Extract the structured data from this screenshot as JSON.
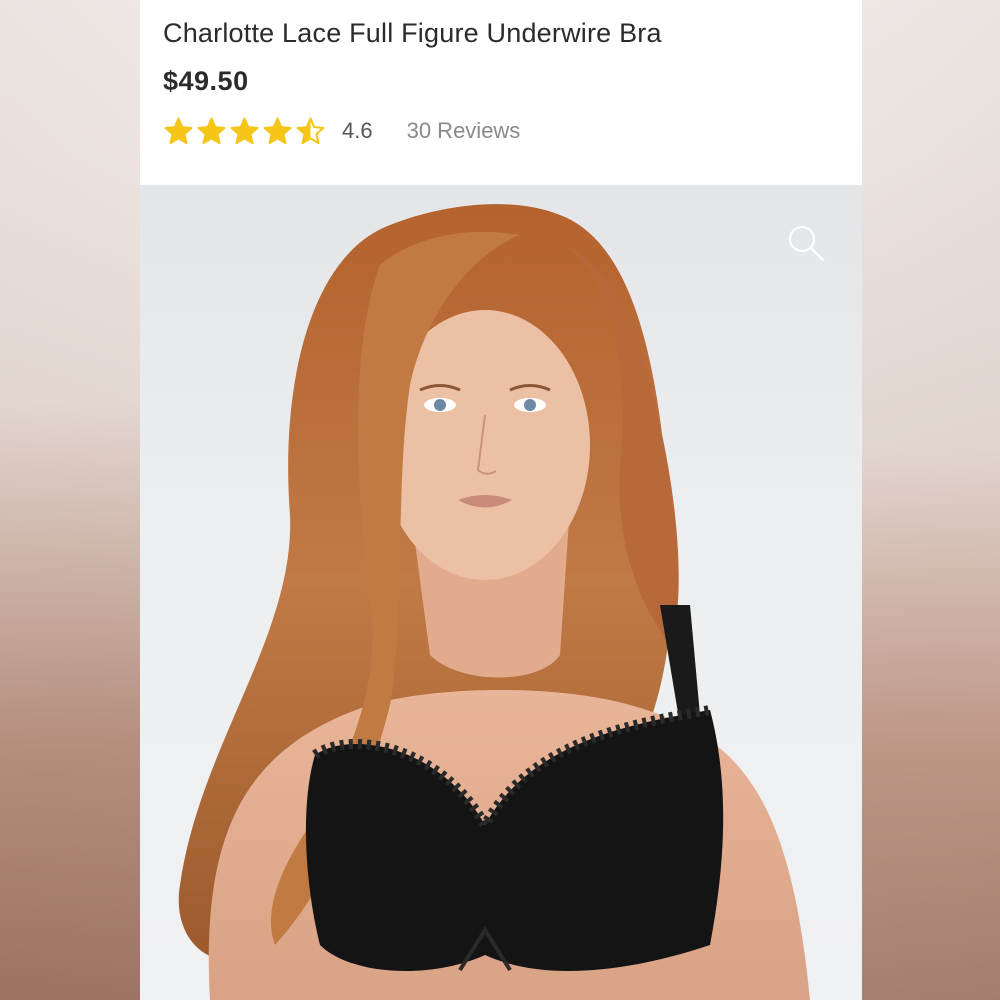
{
  "product": {
    "title": "Charlotte Lace Full Figure Underwire Bra",
    "price": "$49.50",
    "rating": {
      "value": 4.6,
      "value_label": "4.6",
      "stars_max": 5,
      "reviews_label": "30 Reviews",
      "star_color": "#f5c518"
    }
  },
  "gallery": {
    "image_alt": "Model wearing the Charlotte Lace Full Figure Underwire Bra",
    "zoom_icon": "magnifier-icon"
  },
  "colors": {
    "text_primary": "#2b2b2b",
    "text_muted": "#8a8a8a",
    "card_background": "#ffffff"
  }
}
